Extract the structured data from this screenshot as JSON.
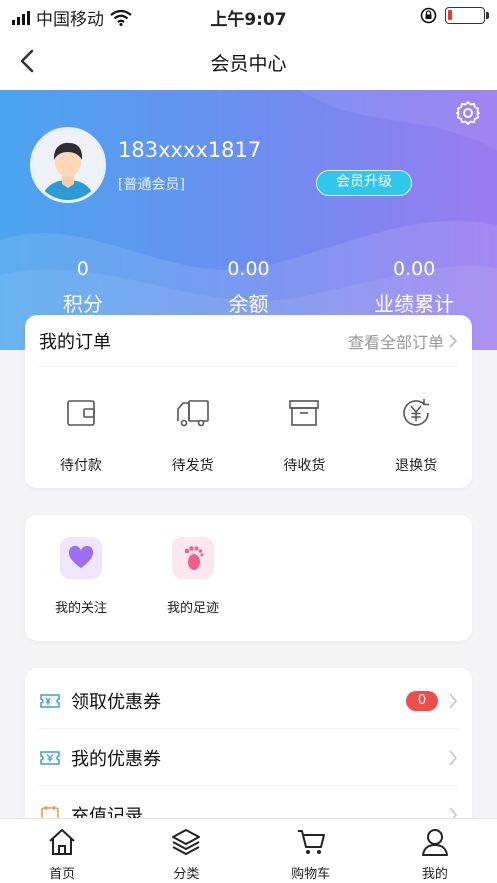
{
  "status_bar": {
    "carrier": "中国移动",
    "time": "上午9:07"
  },
  "nav": {
    "title": "会员中心"
  },
  "profile": {
    "phone": "183xxxx1817",
    "level": "[普通会员]",
    "upgrade_label": "会员升级"
  },
  "stats": [
    {
      "value": "0",
      "label": "积分"
    },
    {
      "value": "0.00",
      "label": "余额"
    },
    {
      "value": "0.00",
      "label": "业绩累计"
    }
  ],
  "orders": {
    "title": "我的订单",
    "view_all": "查看全部订单",
    "items": [
      {
        "label": "待付款",
        "icon": "wallet-icon"
      },
      {
        "label": "待发货",
        "icon": "truck-icon"
      },
      {
        "label": "待收货",
        "icon": "box-icon"
      },
      {
        "label": "退换货",
        "icon": "yen-refund-icon"
      }
    ]
  },
  "shortcuts": [
    {
      "label": "我的关注",
      "icon": "heart-icon",
      "color": "#9b6ff0"
    },
    {
      "label": "我的足迹",
      "icon": "footprint-icon",
      "color": "#f0608a"
    }
  ],
  "menu": [
    {
      "label": "领取优惠券",
      "badge": "0",
      "icon": "coupon-ticket-icon"
    },
    {
      "label": "我的优惠券",
      "icon": "yen-ticket-icon"
    },
    {
      "label": "充值记录",
      "icon": "recharge-icon"
    }
  ],
  "tabs": [
    {
      "label": "首页",
      "icon": "home-icon"
    },
    {
      "label": "分类",
      "icon": "layers-icon"
    },
    {
      "label": "购物车",
      "icon": "cart-icon"
    },
    {
      "label": "我的",
      "icon": "user-icon"
    }
  ],
  "colors": {
    "accent": "#4aa5ef",
    "brand_purple": "#9b7bf0",
    "upgrade": "#2fc7ee",
    "badge": "#f04c4c"
  }
}
